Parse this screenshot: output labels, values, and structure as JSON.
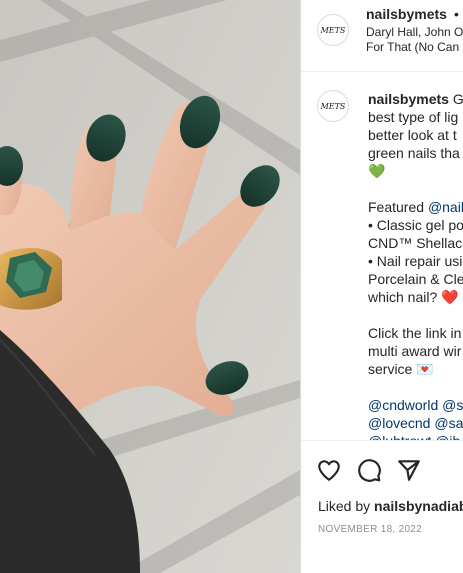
{
  "post": {
    "username": "nailsbymets",
    "follow_separator": "•",
    "avatar_text": "METS",
    "audio_line_1": "Daryl Hall, John O",
    "audio_line_2": "For That (No Can",
    "photo_alt": "Hand with dark green nails and a gold ring against a wall"
  },
  "caption": {
    "username": "nailsbymets",
    "lines": [
      "G",
      "best type of lig",
      "better look at t",
      "green nails tha"
    ],
    "green_heart": "💚",
    "featured_prefix": "Featured ",
    "featured_link": "@nail",
    "bullets": [
      "• Classic gel po",
      "CND™ Shellac",
      "• Nail repair usi",
      "Porcelain & Cle",
      "which nail? "
    ],
    "red_heart": "❤️",
    "cta_lines": [
      "Click the link in",
      "multi award wir",
      "service "
    ],
    "letter_emoji": "💌",
    "tag_lines": [
      "@cndworld @s",
      "@lovecnd @sa",
      "@luhtrowt @ib"
    ]
  },
  "actions": {
    "like_icon": "heart-outline-icon",
    "comment_icon": "comment-icon",
    "share_icon": "paper-plane-icon"
  },
  "likes": {
    "prefix": "Liked by ",
    "user": "nailsbynadiab"
  },
  "date": "NOVEMBER 18, 2022",
  "colors": {
    "nail": "#1f3d33",
    "link": "#00376b",
    "muted": "#8e8e8e",
    "border": "#dbdbdb"
  }
}
